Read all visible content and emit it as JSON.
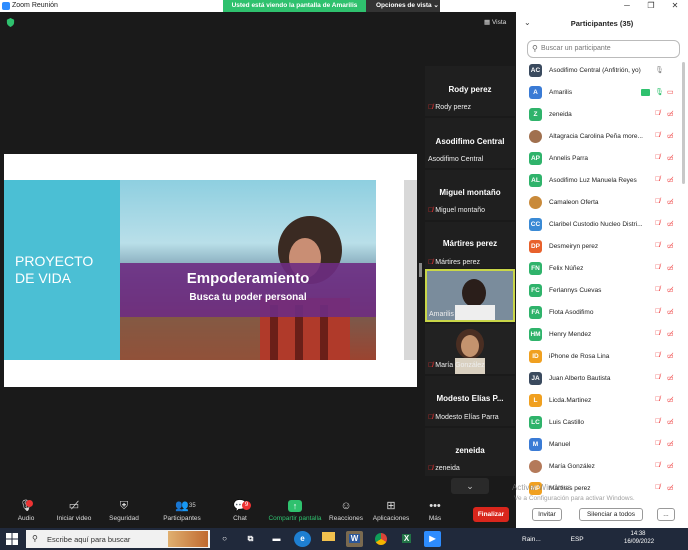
{
  "window": {
    "title": "Zoom Reunión",
    "banner": "Usted está viendo la pantalla de Amarilis",
    "view_options": "Opciones de vista ⌄"
  },
  "meeting": {
    "view_label": "Vista"
  },
  "slide": {
    "title": "PROYECTO DE VIDA",
    "heading": "Empoderamiento",
    "subheading": "Busca tu poder personal"
  },
  "tiles": [
    {
      "name_big": "Rody perez",
      "label": "Rody perez"
    },
    {
      "name_big": "Asodifimo Central",
      "label": "Asodifimo Central"
    },
    {
      "name_big": "Miguel montaño",
      "label": "Miguel montaño"
    },
    {
      "name_big": "Mártires perez",
      "label": "Mártires perez"
    },
    {
      "label": "Amarilis"
    },
    {
      "label": "María González"
    },
    {
      "name_big": "Modesto  Elías  P...",
      "label": "Modesto Elías Parra"
    },
    {
      "name_big": "zeneida",
      "label": "zeneida"
    }
  ],
  "toolbar": {
    "audio": "Audio",
    "video": "Iniciar video",
    "security": "Seguridad",
    "participants": "Participantes",
    "participants_count": "35",
    "chat": "Chat",
    "chat_badge": "9",
    "share": "Compartir pantalla",
    "reactions": "Reacciones",
    "apps": "Aplicaciones",
    "more": "Más",
    "end": "Finalizar"
  },
  "participants": {
    "title": "Participantes (35)",
    "search_placeholder": "Buscar un participante",
    "list": [
      {
        "initials": "AC",
        "name": "Asodifimo Central (Anfitrión, yo)",
        "color": "#3a4a5e"
      },
      {
        "initials": "A",
        "name": "Amarilis",
        "color": "#3a7bd5"
      },
      {
        "initials": "Z",
        "name": "zeneida",
        "color": "#2fb36b"
      },
      {
        "initials": "",
        "name": "Altagracia Carolina Peña more...",
        "color": "#a0704e"
      },
      {
        "initials": "AP",
        "name": "Annelis Parra",
        "color": "#2fb36b"
      },
      {
        "initials": "AL",
        "name": "Asodifimo Luz Manuela Reyes",
        "color": "#2fb36b"
      },
      {
        "initials": "",
        "name": "Camaleon Oferta",
        "color": "#c98a3a"
      },
      {
        "initials": "CC",
        "name": "Claribel Custodio Nucleo Distri...",
        "color": "#3a8ad5"
      },
      {
        "initials": "DP",
        "name": "Desmeiryn perez",
        "color": "#e8612c"
      },
      {
        "initials": "FN",
        "name": "Felix Núñez",
        "color": "#2fb36b"
      },
      {
        "initials": "FC",
        "name": "Ferlannys Cuevas",
        "color": "#2fb36b"
      },
      {
        "initials": "FA",
        "name": "Flota Asodifimo",
        "color": "#2fb36b"
      },
      {
        "initials": "HM",
        "name": "Henry Mendez",
        "color": "#2fb36b"
      },
      {
        "initials": "ID",
        "name": "iPhone de Rosa Lina",
        "color": "#f0a020"
      },
      {
        "initials": "JA",
        "name": "Juan Alberto Bautista",
        "color": "#3a4a5e"
      },
      {
        "initials": "L",
        "name": "Licda.Martinez",
        "color": "#f0a020"
      },
      {
        "initials": "LC",
        "name": "Luis Castillo",
        "color": "#2fb36b"
      },
      {
        "initials": "M",
        "name": "Manuel",
        "color": "#3a7bd5"
      },
      {
        "initials": "",
        "name": "María González",
        "color": "#b47a5a"
      },
      {
        "initials": "MP",
        "name": "Mártires perez",
        "color": "#f0a020"
      }
    ],
    "invite": "Invitar",
    "mute_all": "Silenciar a todos",
    "more": "..."
  },
  "watermark": {
    "line1": "Activar Windows",
    "line2": "Ve a Configuración para activar Windows."
  },
  "taskbar": {
    "search_placeholder": "Escribe aquí para buscar",
    "weather": "Rain...",
    "lang": "ESP",
    "time": "14:38",
    "date": "16/09/2022"
  },
  "colors": {
    "zoom_blue": "#2d8cff",
    "share_green": "#2fc16e",
    "end_red": "#d9261c",
    "mute_red": "#e33333"
  }
}
